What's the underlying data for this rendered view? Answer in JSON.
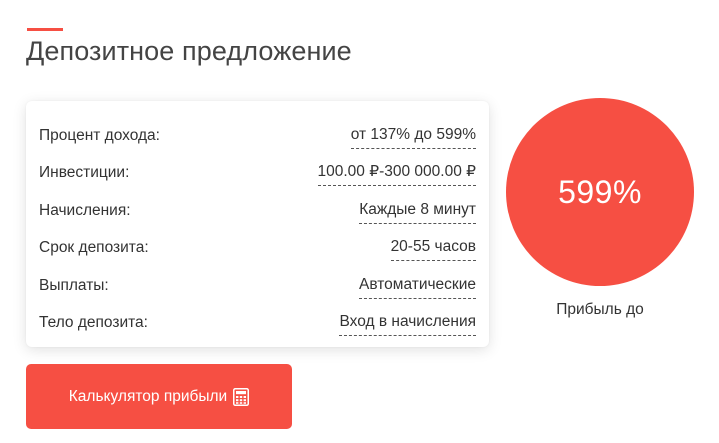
{
  "header": {
    "title": "Депозитное предложение"
  },
  "deposit": {
    "rows": [
      {
        "label": "Процент дохода:",
        "value": "от 137% до 599%"
      },
      {
        "label": "Инвестиции:",
        "value": "100.00 ₽-300 000.00 ₽"
      },
      {
        "label": "Начисления:",
        "value": "Каждые 8 минут"
      },
      {
        "label": "Срок депозита:",
        "value": "20-55 часов"
      },
      {
        "label": "Выплаты:",
        "value": "Автоматические"
      },
      {
        "label": "Тело депозита:",
        "value": "Вход в начисления"
      }
    ]
  },
  "calculator": {
    "label": "Калькулятор прибыли",
    "icon": "calculator-icon"
  },
  "profit": {
    "percent": "599%",
    "label": "Прибыль до"
  },
  "colors": {
    "accent": "#f64f43",
    "text": "#333333"
  }
}
